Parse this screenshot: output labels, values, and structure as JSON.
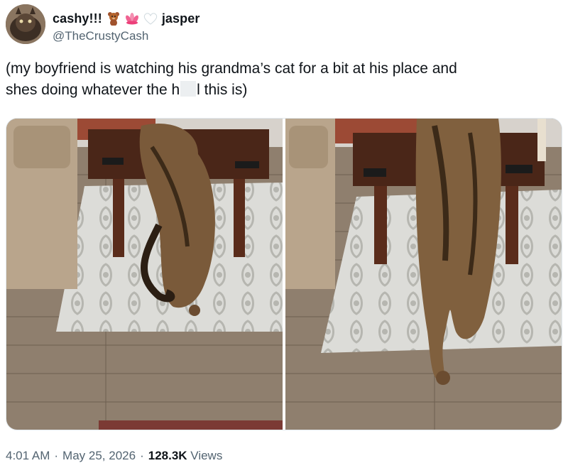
{
  "author": {
    "display_name": "cashy!!!",
    "display_name_suffix": "jasper",
    "handle": "@TheCrustyCash",
    "emojis": [
      "teddy-bear-emoji",
      "lotus-emoji",
      "white-heart-emoji"
    ]
  },
  "tweet": {
    "text_part1": "(my boyfriend is watching his grandma’s cat for a bit at his place and",
    "text_part2_before": "shes doing whatever the h",
    "text_part2_after": "l this is)"
  },
  "meta": {
    "time": "4:01 AM",
    "date": "May 25, 2026",
    "separator": "·",
    "views_count": "128.3K",
    "views_label": "Views"
  },
  "colors": {
    "text_primary": "#0f1419",
    "text_secondary": "#536471"
  }
}
